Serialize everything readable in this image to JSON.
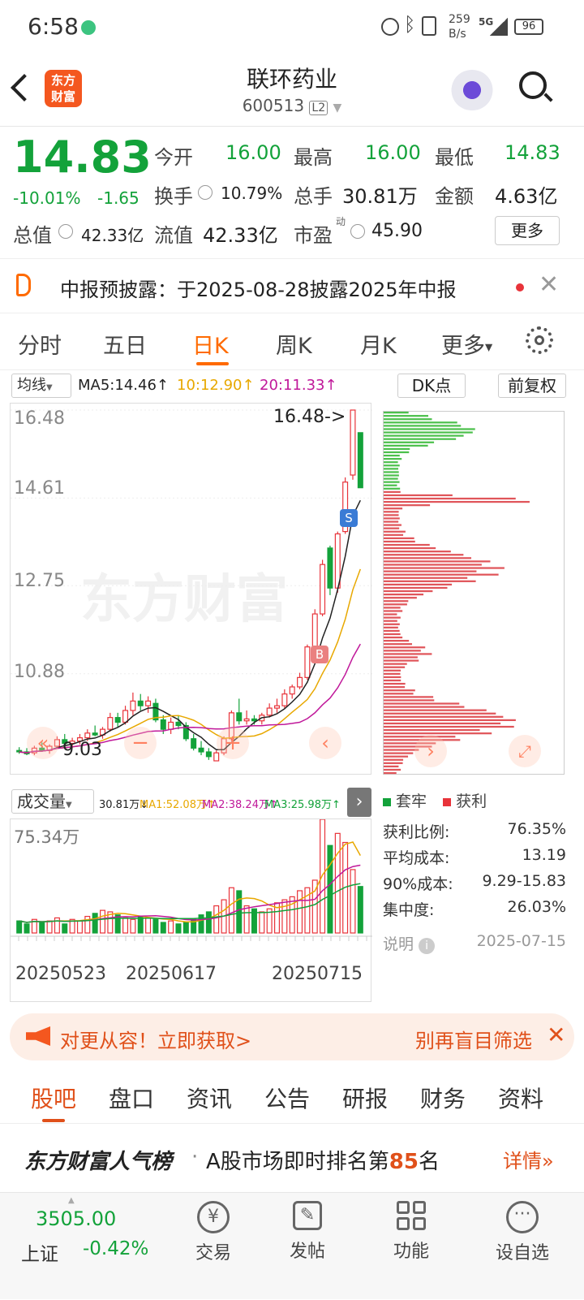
{
  "status_bar": {
    "time": "6:58",
    "net_speed_value": "259",
    "net_speed_unit": "B/s",
    "net_type": "5G",
    "battery": "96"
  },
  "header": {
    "title": "联环药业",
    "code": "600513",
    "badge": "L2",
    "logo_line1": "东方",
    "logo_line2": "财富"
  },
  "quote": {
    "price": "14.83",
    "change_pct": "-10.01%",
    "change_amt": "-1.65",
    "open_label": "今开",
    "open": "16.00",
    "high_label": "最高",
    "high": "16.00",
    "low_label": "最低",
    "low": "14.83",
    "turnover_label": "换手",
    "turnover": "10.79%",
    "volume_label": "总手",
    "volume": "30.81万",
    "amount_label": "金额",
    "amount": "4.63亿",
    "mktcap_label": "总值",
    "mktcap": "42.33亿",
    "float_label": "流值",
    "float_cap": "42.33亿",
    "pe_label": "市盈",
    "pe_sup": "动",
    "pe": "45.90",
    "more_button": "更多"
  },
  "notice": {
    "text": "中报预披露：于2025-08-28披露2025年中报"
  },
  "period_tabs": [
    "分时",
    "五日",
    "日K",
    "周K",
    "月K"
  ],
  "period_more": "更多",
  "active_tab_index": 2,
  "ma_bar": {
    "selector": "均线",
    "ma5": "MA5:14.46",
    "ma10": "10:12.90",
    "ma20": "20:11.33",
    "arrow": "↑",
    "dk_button": "DK点",
    "fq_button": "前复权"
  },
  "kline": {
    "y_labels": [
      "16.48",
      "14.61",
      "12.75",
      "10.88"
    ],
    "peak_label": "16.48->",
    "low_label": "9.03",
    "buy_marker": "B",
    "sell_marker": "S",
    "watermark": "东方财富"
  },
  "volume": {
    "selector": "成交量",
    "today": "30.81万↓",
    "ma1": "MA1:52.08万↑",
    "ma2": "MA2:38.24万↑",
    "ma3": "MA3:25.98万↑",
    "max_label": "75.34万",
    "dates": [
      "20250523",
      "20250617",
      "20250715"
    ]
  },
  "chips": {
    "legend_trapped": "套牢",
    "legend_profit": "获利",
    "rows": [
      {
        "label": "获利比例:",
        "value": "76.35%"
      },
      {
        "label": "平均成本:",
        "value": "13.19"
      },
      {
        "label": "90%成本:",
        "value": "9.29-15.83"
      },
      {
        "label": "集中度:",
        "value": "26.03%"
      }
    ],
    "explain": "说明",
    "date": "2025-07-15"
  },
  "promo": {
    "left": "对更从容！立即获取>",
    "right": "别再盲目筛选"
  },
  "section_tabs": [
    "股吧",
    "盘口",
    "资讯",
    "公告",
    "研报",
    "财务",
    "资料"
  ],
  "rank": {
    "brand": "东方财富人气榜",
    "text": "A股市场即时排名第",
    "rank": "85",
    "suffix": "名",
    "detail": "详情"
  },
  "bottom_nav": {
    "index_value": "3505.00",
    "index_name": "上证",
    "index_change": "-0.42%",
    "items": [
      "交易",
      "发帖",
      "功能",
      "设自选"
    ]
  },
  "colors": {
    "up": "#e8333a",
    "down": "#13a23a",
    "accent": "#ff6a00"
  },
  "chart_data": {
    "type": "candlestick",
    "ohlc": [
      [
        9.25,
        9.32,
        9.18,
        9.22
      ],
      [
        9.22,
        9.3,
        9.15,
        9.18
      ],
      [
        9.2,
        9.35,
        9.15,
        9.3
      ],
      [
        9.3,
        9.42,
        9.22,
        9.25
      ],
      [
        9.25,
        9.38,
        9.18,
        9.34
      ],
      [
        9.34,
        9.55,
        9.3,
        9.48
      ],
      [
        9.48,
        9.6,
        9.35,
        9.4
      ],
      [
        9.4,
        9.52,
        9.3,
        9.45
      ],
      [
        9.45,
        9.6,
        9.38,
        9.52
      ],
      [
        9.52,
        9.7,
        9.45,
        9.62
      ],
      [
        9.62,
        9.78,
        9.55,
        9.58
      ],
      [
        9.58,
        9.75,
        9.5,
        9.7
      ],
      [
        9.7,
        10.05,
        9.65,
        9.95
      ],
      [
        9.95,
        10.05,
        9.75,
        9.85
      ],
      [
        9.85,
        10.2,
        9.8,
        10.1
      ],
      [
        10.1,
        10.48,
        10.0,
        10.3
      ],
      [
        10.3,
        10.45,
        10.1,
        10.2
      ],
      [
        10.2,
        10.4,
        10.05,
        10.3
      ],
      [
        10.25,
        10.35,
        9.85,
        9.9
      ],
      [
        9.9,
        10.0,
        9.6,
        9.7
      ],
      [
        9.7,
        9.95,
        9.6,
        9.85
      ],
      [
        9.85,
        10.0,
        9.7,
        9.78
      ],
      [
        9.78,
        9.85,
        9.45,
        9.5
      ],
      [
        9.5,
        9.6,
        9.25,
        9.3
      ],
      [
        9.3,
        9.45,
        9.15,
        9.22
      ],
      [
        9.22,
        9.3,
        9.05,
        9.12
      ],
      [
        9.03,
        9.25,
        9.03,
        9.2
      ],
      [
        9.2,
        9.55,
        9.15,
        9.5
      ],
      [
        9.5,
        10.1,
        9.45,
        10.05
      ],
      [
        10.05,
        10.35,
        9.8,
        9.88
      ],
      [
        9.88,
        10.1,
        9.8,
        9.92
      ],
      [
        9.92,
        10.0,
        9.8,
        9.88
      ],
      [
        9.88,
        10.05,
        9.8,
        10.0
      ],
      [
        10.0,
        10.25,
        9.95,
        10.15
      ],
      [
        10.15,
        10.35,
        10.05,
        10.2
      ],
      [
        10.2,
        10.55,
        10.15,
        10.45
      ],
      [
        10.45,
        10.65,
        10.35,
        10.6
      ],
      [
        10.6,
        10.9,
        10.55,
        10.8
      ],
      [
        10.8,
        11.5,
        10.75,
        11.45
      ],
      [
        11.45,
        12.25,
        11.4,
        12.15
      ],
      [
        12.15,
        13.3,
        12.1,
        13.2
      ],
      [
        13.55,
        13.6,
        12.55,
        12.7
      ],
      [
        12.7,
        13.9,
        12.6,
        13.85
      ],
      [
        13.9,
        15.05,
        13.85,
        14.95
      ],
      [
        15.1,
        16.48,
        15.0,
        16.48
      ],
      [
        16.0,
        16.0,
        14.83,
        14.83
      ]
    ],
    "ma5_last": 14.46,
    "ma10_last": 12.9,
    "ma20_last": 11.33,
    "volume_wan": [
      8,
      6,
      9,
      7,
      8,
      10,
      6,
      9,
      8,
      11,
      13,
      15,
      14,
      12,
      10,
      9,
      11,
      10,
      9,
      7,
      8,
      6,
      7,
      9,
      12,
      14,
      18,
      22,
      30,
      28,
      18,
      16,
      14,
      16,
      20,
      22,
      24,
      28,
      30,
      35,
      75.34,
      58,
      66,
      60,
      42,
      30.81
    ],
    "y_range": [
      9.03,
      16.48
    ],
    "x_dates": [
      "20250523",
      "20250617",
      "20250715"
    ]
  }
}
